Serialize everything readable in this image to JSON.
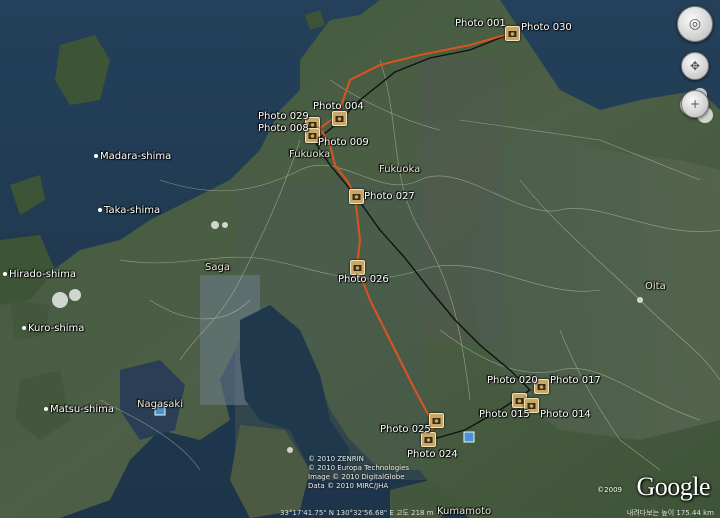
{
  "photos": [
    {
      "id": "photo-001",
      "label": "Photo 001"
    },
    {
      "id": "photo-030",
      "label": "Photo 030"
    },
    {
      "id": "photo-004",
      "label": "Photo 004"
    },
    {
      "id": "photo-029",
      "label": "Photo 029"
    },
    {
      "id": "photo-008",
      "label": "Photo 008"
    },
    {
      "id": "photo-009",
      "label": "Photo 009"
    },
    {
      "id": "photo-027",
      "label": "Photo 027"
    },
    {
      "id": "photo-026",
      "label": "Photo 026"
    },
    {
      "id": "photo-020",
      "label": "Photo 020"
    },
    {
      "id": "photo-017",
      "label": "Photo 017"
    },
    {
      "id": "photo-015",
      "label": "Photo 015"
    },
    {
      "id": "photo-014",
      "label": "Photo 014"
    },
    {
      "id": "photo-025",
      "label": "Photo 025"
    },
    {
      "id": "photo-024",
      "label": "Photo 024"
    }
  ],
  "places": {
    "fukuoka_city": "Fukuoka",
    "fukuoka_pref": "Fukuoka",
    "saga": "Saga",
    "oita": "Oita",
    "nagasaki": "Nagasaki",
    "kumamoto": "Kumamoto",
    "madara": "Madara-shima",
    "taka": "Taka-shima",
    "hirado": "Hirado-shima",
    "kuro": "Kuro-shima",
    "matsu": "Matsu-shima"
  },
  "attribution": {
    "line1": "© 2010 ZENRIN",
    "line2": "© 2010 Europa Technologies",
    "line3": "Image © 2010 DigitalGlobe",
    "line4": "Data © 2010 MIRC/JHA",
    "logo_copy": "©2009",
    "logo": "Google"
  },
  "status": {
    "coords": "33°17'41.75\" N   130°32'56.68\" E   고도   218 m",
    "right": "내려다보는 높이   175.44 km"
  },
  "controls": {
    "look": "◎",
    "move": "✥",
    "zoom_in": "+"
  },
  "colors": {
    "route": "#d9541e",
    "track": "#111111"
  }
}
